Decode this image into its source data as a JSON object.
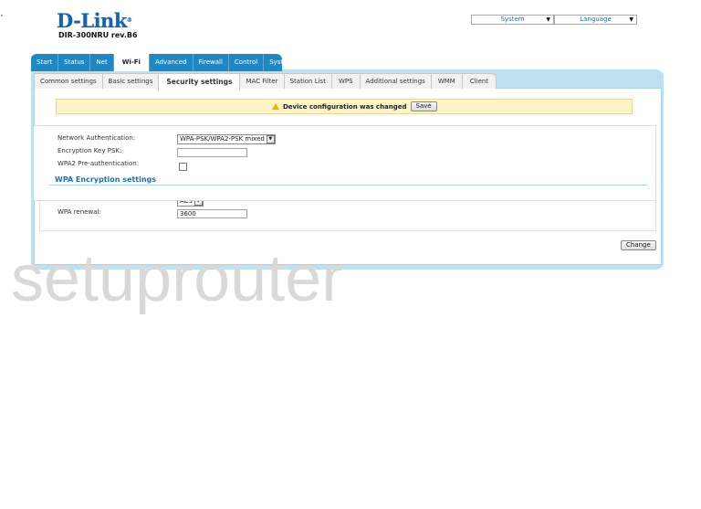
{
  "brand": {
    "logo": "D-Link",
    "model": "DIR-300NRU rev.B6"
  },
  "top_selects": {
    "system": "System",
    "language": "Language"
  },
  "main_tabs": [
    {
      "label": "Start",
      "active": false
    },
    {
      "label": "Status",
      "active": false
    },
    {
      "label": "Net",
      "active": false
    },
    {
      "label": "Wi-Fi",
      "active": true
    },
    {
      "label": "Advanced",
      "active": false
    },
    {
      "label": "Firewall",
      "active": false
    },
    {
      "label": "Control",
      "active": false
    },
    {
      "label": "System",
      "active": false
    }
  ],
  "sub_tabs": [
    {
      "label": "Common settings",
      "active": false
    },
    {
      "label": "Basic settings",
      "active": false
    },
    {
      "label": "Security settings",
      "active": true
    },
    {
      "label": "MAC Filter",
      "active": false
    },
    {
      "label": "Station List",
      "active": false
    },
    {
      "label": "WPS",
      "active": false
    },
    {
      "label": "Additional settings",
      "active": false
    },
    {
      "label": "WMM",
      "active": false
    },
    {
      "label": "Client",
      "active": false
    }
  ],
  "notice": {
    "icon": "warning-icon",
    "text": "Device configuration was changed",
    "save_label": "Save"
  },
  "form": {
    "network_auth": {
      "label": "Network Authentication:",
      "value": "WPA-PSK/WPA2-PSK mixed"
    },
    "psk": {
      "label": "Encryption Key PSK:",
      "value": ""
    },
    "preauth": {
      "label": "WPA2 Pre-authentication:",
      "checked": false
    },
    "section_title": "WPA Encryption settings",
    "wpa_encryption": {
      "value": "AES"
    },
    "wpa_renewal": {
      "label": "WPA renewal:",
      "value": "3600"
    }
  },
  "change_label": "Change",
  "watermark": "setuprouter"
}
